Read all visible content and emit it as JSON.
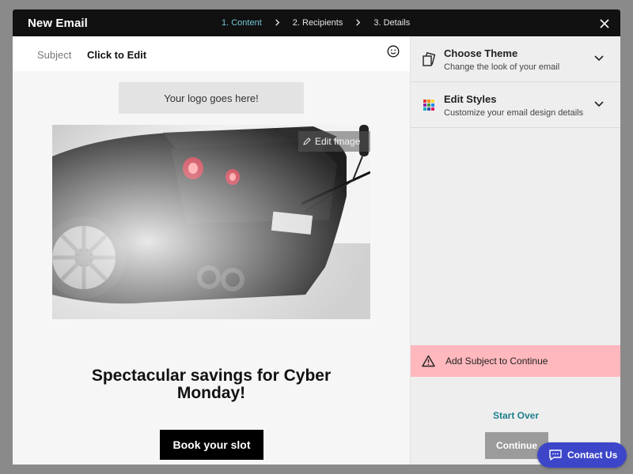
{
  "header": {
    "title": "New Email",
    "steps": [
      {
        "label": "1. Content",
        "active": true
      },
      {
        "label": "2. Recipients",
        "active": false
      },
      {
        "label": "3. Details",
        "active": false
      }
    ],
    "close_icon": "close-icon"
  },
  "subject": {
    "label": "Subject",
    "value": "Click to Edit",
    "emoji_icon": "smiley-icon"
  },
  "email": {
    "logo_placeholder": "Your logo goes here!",
    "edit_image_label": "Edit Image",
    "headline": "Spectacular savings for Cyber Monday!",
    "cta_label": "Book your slot"
  },
  "panel": {
    "items": [
      {
        "title": "Choose Theme",
        "subtitle": "Change the look of your email",
        "icon": "theme-icon"
      },
      {
        "title": "Edit Styles",
        "subtitle": "Customize your email design details",
        "icon": "palette-icon"
      }
    ],
    "alert": {
      "text": "Add Subject to Continue",
      "icon": "warning-icon",
      "color": "#ffb8bd"
    },
    "start_over_label": "Start Over",
    "continue_label": "Continue"
  },
  "contact": {
    "label": "Contact Us",
    "icon": "chat-icon",
    "color": "#3d46c9"
  },
  "colors": {
    "active_step": "#74c6d4",
    "link": "#1e7f8c",
    "topbar": "#111111"
  }
}
